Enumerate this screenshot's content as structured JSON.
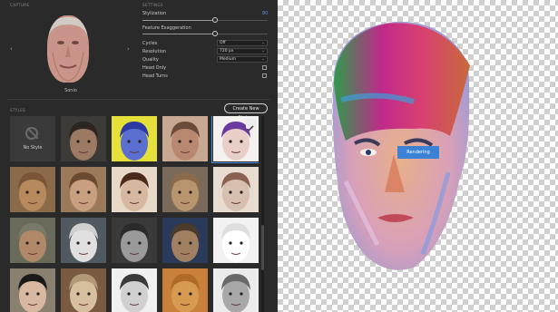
{
  "capture": {
    "header": "CAPTURE",
    "name": "Sonio",
    "prev_icon": "chevron-left-icon",
    "next_icon": "chevron-right-icon"
  },
  "settings": {
    "header": "SETTINGS",
    "stylization": {
      "label": "Stylization",
      "value": "80",
      "fraction": 0.58
    },
    "feature_exaggeration": {
      "label": "Feature Exaggeration",
      "value": "",
      "fraction": 0.58
    },
    "cycles": {
      "label": "Cycles",
      "value": "Off"
    },
    "resolution": {
      "label": "Resolution",
      "value": "720 px"
    },
    "quality": {
      "label": "Quality",
      "value": "Medium"
    },
    "head_only": {
      "label": "Head Only",
      "checked": false
    },
    "head_turns": {
      "label": "Head Turns",
      "checked": false
    }
  },
  "styles": {
    "header": "STYLES",
    "create_label": "Create New Style...",
    "no_style_label": "No Style",
    "selected_index": 4,
    "tiles": [
      {
        "name": "no-style"
      },
      {
        "name": "photo-man-dark",
        "bg": "#3c3b38",
        "skin": "#9c7a64",
        "hair": "#2c2520"
      },
      {
        "name": "yellow-pop-art",
        "bg": "#e6e03a",
        "skin": "#5a6fd0",
        "hair": "#2b3aa0"
      },
      {
        "name": "curly-sketch",
        "bg": "#c8a890",
        "skin": "#b88870",
        "hair": "#6a4a3a"
      },
      {
        "name": "rainbow-girl",
        "bg": "#f4f2f0",
        "skin": "#e8d0c8",
        "hair": "#6a3aa0"
      },
      {
        "name": "wood-carving",
        "bg": "#8a6a48",
        "skin": "#b68a5c",
        "hair": "#7a5436"
      },
      {
        "name": "woman-painting",
        "bg": "#9a7a5a",
        "skin": "#c8a080",
        "hair": "#6a4a30"
      },
      {
        "name": "ink-curly-woman",
        "bg": "#e8d8c8",
        "skin": "#d6b8a0",
        "hair": "#4a2a1a"
      },
      {
        "name": "clay-figure",
        "bg": "#7a6a5a",
        "skin": "#b8956f",
        "hair": "#8a6a4a"
      },
      {
        "name": "pencil-sketch-girl",
        "bg": "#e8dcd0",
        "skin": "#d8c0b0",
        "hair": "#8a6050"
      },
      {
        "name": "old-man-painting",
        "bg": "#6a6a5a",
        "skin": "#b08a68",
        "hair": "#7a7a6a"
      },
      {
        "name": "white-bust",
        "bg": "#505860",
        "skin": "#e0e0e0",
        "hair": "#cfcfcf"
      },
      {
        "name": "bw-man-photo",
        "bg": "#3a3a3a",
        "skin": "#9a9a9a",
        "hair": "#2a2a2a"
      },
      {
        "name": "man-portrait-blue",
        "bg": "#2a3a5a",
        "skin": "#a08060",
        "hair": "#4a3a2a"
      },
      {
        "name": "line-drawing-man",
        "bg": "#f2f2f2",
        "skin": "#ffffff",
        "hair": "#dedede"
      },
      {
        "name": "bob-hair-woman",
        "bg": "#8a8070",
        "skin": "#d8b8a0",
        "hair": "#1a1a1a"
      },
      {
        "name": "stone-statue",
        "bg": "#7a5a40",
        "skin": "#d6c0a0",
        "hair": "#b09878"
      },
      {
        "name": "engraving-man",
        "bg": "#f0f0f0",
        "skin": "#d0d0d0",
        "hair": "#3a3a3a"
      },
      {
        "name": "dog",
        "bg": "#c8803a",
        "skin": "#d69a50",
        "hair": "#b06a28"
      },
      {
        "name": "ink-pattern-face",
        "bg": "#ececec",
        "skin": "#a8a8a8",
        "hair": "#6a6a6a"
      }
    ]
  },
  "canvas": {
    "render_label": "Rendering"
  },
  "icons": {
    "edit": "pencil-icon",
    "none": "no-entry-icon"
  }
}
